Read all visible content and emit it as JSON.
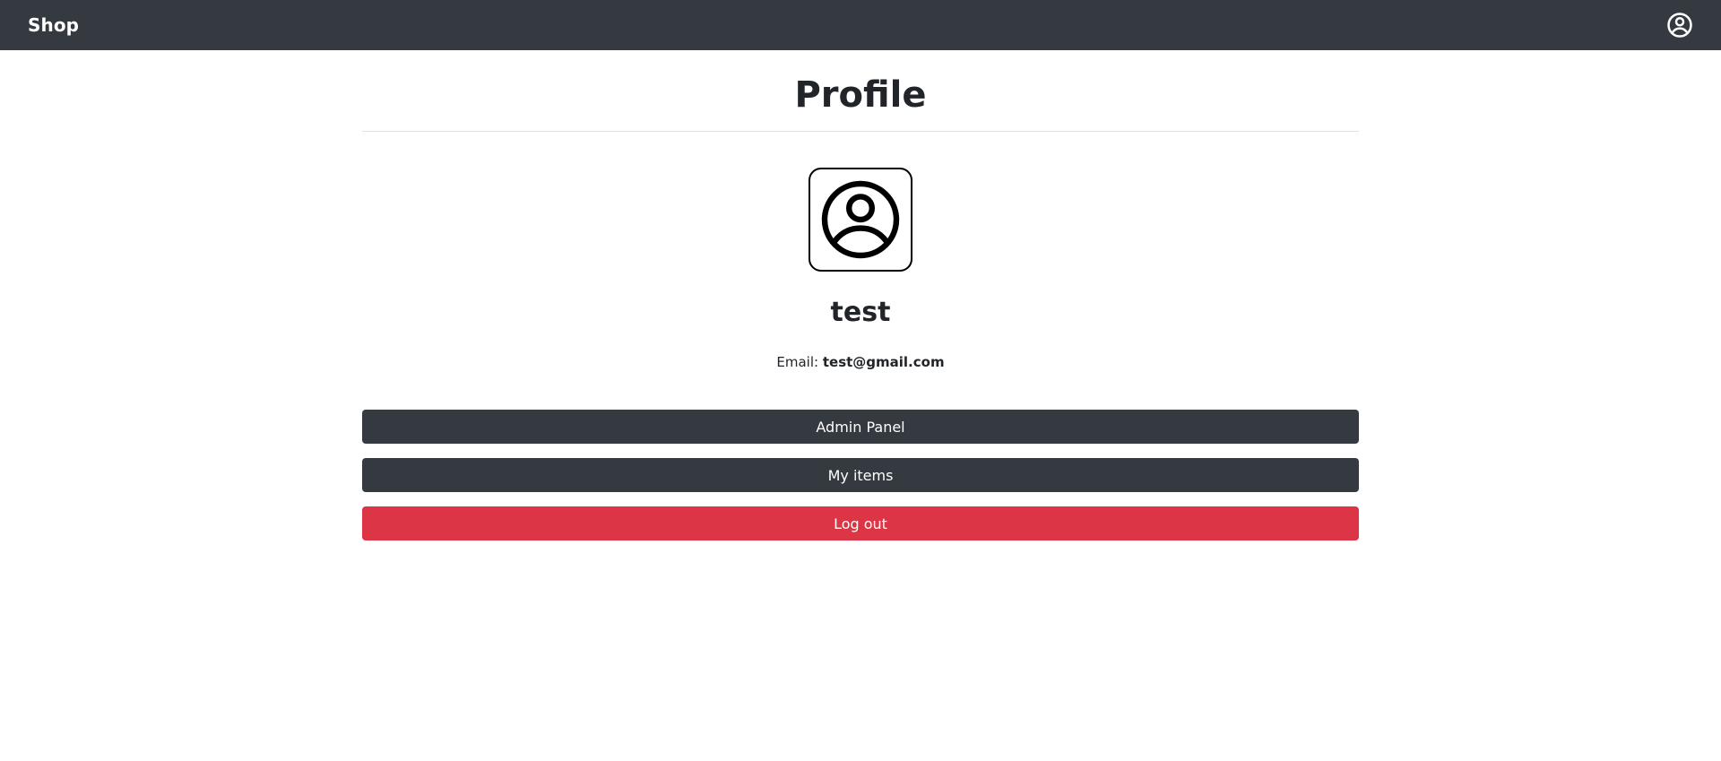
{
  "navbar": {
    "brand": "Shop",
    "user_icon": "user-circle-icon"
  },
  "profile": {
    "title": "Profile",
    "avatar_icon": "user-circle-icon",
    "username": "test",
    "email_label": "Email:",
    "email_value": "test@gmail.com"
  },
  "actions": {
    "admin_panel": "Admin Panel",
    "my_items": "My items",
    "log_out": "Log out"
  },
  "colors": {
    "navbar_bg": "#343a40",
    "dark_button": "#343a40",
    "danger_button": "#dc3545"
  }
}
